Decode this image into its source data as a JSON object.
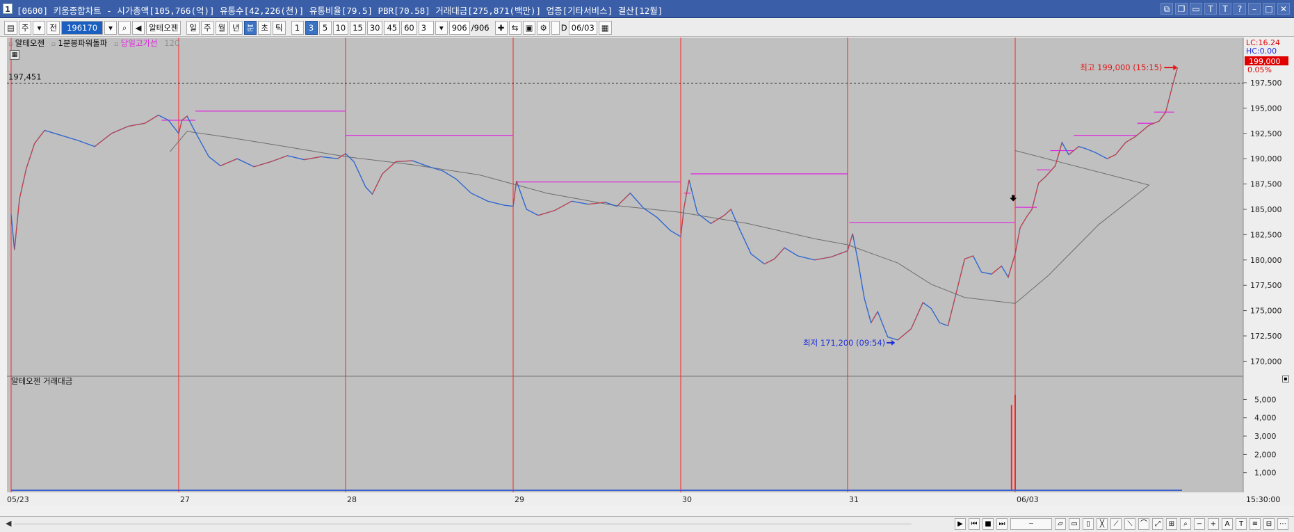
{
  "window": {
    "icon_label": "1",
    "title": "[0600] 키움종합차트 - 시가총액[105,766(억)] 유통수[42,226(천)] 유통비율[79.5] PBR[70.58] 거래대금[275,871(백만)] 업종[기타서비스] 결산[12월]"
  },
  "toolbar": {
    "period_sel": "주",
    "prev_btn": "전",
    "stock_code": "196170",
    "stock_name_btn": "알테오젠",
    "tf_day": "일",
    "tf_week": "주",
    "tf_month": "월",
    "tf_year": "년",
    "tf_minute": "분",
    "tf_second": "초",
    "tf_tick": "틱",
    "intervals": [
      "1",
      "3",
      "5",
      "10",
      "15",
      "30",
      "45",
      "60"
    ],
    "interval_selected": "3",
    "count_value": "3",
    "range_value": "906",
    "range_total": "/906",
    "d_label": "D",
    "date_value": "06/03"
  },
  "legend": {
    "stock": "알테오젠",
    "indicator1": "1분봉파워돌파",
    "indicator2": "당일고가선",
    "indicator2_param": "120",
    "current_ref_price": "197,451",
    "max_label": "최고 199,000 (15:15)",
    "min_label": "최저 171,200 (09:54)",
    "lc_label": "LC:16.24",
    "hc_label": "HC:0.00",
    "current_price": "199,000",
    "current_pct": "0.05%",
    "volume_title": "알테오젠 거래대금",
    "time_label": "15:30:00"
  },
  "chart_data": {
    "type": "line",
    "title": "",
    "xlabel": "",
    "ylabel": "",
    "x_date_labels": [
      "05/23",
      "27",
      "28",
      "29",
      "30",
      "31",
      "06/03"
    ],
    "price_axis": {
      "ylim": [
        169000,
        201000
      ],
      "ticks": [
        170000,
        172500,
        175000,
        177500,
        180000,
        182500,
        185000,
        187500,
        190000,
        192500,
        195000,
        197500
      ],
      "tick_labels": [
        "170,000",
        "172,500",
        "175,000",
        "177,500",
        "180,000",
        "182,500",
        "185,000",
        "187,500",
        "190,000",
        "192,500",
        "195,000",
        "197,500"
      ]
    },
    "volume_axis": {
      "ylim": [
        0,
        5700
      ],
      "ticks": [
        1000,
        2000,
        3000,
        4000,
        5000
      ],
      "tick_labels": [
        "1,000",
        "2,000",
        "3,000",
        "4,000",
        "5,000"
      ]
    },
    "price_path": [
      [
        0,
        184500
      ],
      [
        0.02,
        181000
      ],
      [
        0.05,
        186000
      ],
      [
        0.09,
        189000
      ],
      [
        0.14,
        191500
      ],
      [
        0.2,
        192800
      ],
      [
        0.3,
        192300
      ],
      [
        0.4,
        191800
      ],
      [
        0.5,
        191200
      ],
      [
        0.6,
        192500
      ],
      [
        0.7,
        193200
      ],
      [
        0.8,
        193500
      ],
      [
        0.88,
        194300
      ],
      [
        0.94,
        193800
      ],
      [
        1.0,
        192500
      ],
      [
        1.02,
        193800
      ],
      [
        1.05,
        194200
      ],
      [
        1.1,
        192600
      ],
      [
        1.18,
        190200
      ],
      [
        1.25,
        189300
      ],
      [
        1.35,
        190000
      ],
      [
        1.45,
        189200
      ],
      [
        1.55,
        189700
      ],
      [
        1.65,
        190300
      ],
      [
        1.75,
        189900
      ],
      [
        1.85,
        190200
      ],
      [
        1.95,
        190000
      ],
      [
        2.0,
        190500
      ],
      [
        2.05,
        189700
      ],
      [
        2.12,
        187200
      ],
      [
        2.16,
        186500
      ],
      [
        2.22,
        188500
      ],
      [
        2.3,
        189700
      ],
      [
        2.4,
        189800
      ],
      [
        2.5,
        189200
      ],
      [
        2.58,
        188800
      ],
      [
        2.66,
        188000
      ],
      [
        2.75,
        186600
      ],
      [
        2.85,
        185800
      ],
      [
        2.95,
        185400
      ],
      [
        3.0,
        185300
      ],
      [
        3.02,
        187800
      ],
      [
        3.08,
        185000
      ],
      [
        3.15,
        184400
      ],
      [
        3.25,
        184900
      ],
      [
        3.35,
        185800
      ],
      [
        3.45,
        185500
      ],
      [
        3.55,
        185700
      ],
      [
        3.62,
        185300
      ],
      [
        3.7,
        186600
      ],
      [
        3.78,
        185100
      ],
      [
        3.86,
        184200
      ],
      [
        3.94,
        182900
      ],
      [
        4.0,
        182300
      ],
      [
        4.02,
        185200
      ],
      [
        4.05,
        187900
      ],
      [
        4.1,
        184600
      ],
      [
        4.18,
        183600
      ],
      [
        4.26,
        184400
      ],
      [
        4.3,
        185000
      ],
      [
        4.35,
        183100
      ],
      [
        4.42,
        180600
      ],
      [
        4.5,
        179600
      ],
      [
        4.56,
        180100
      ],
      [
        4.62,
        181200
      ],
      [
        4.7,
        180400
      ],
      [
        4.8,
        180000
      ],
      [
        4.9,
        180300
      ],
      [
        5.0,
        180900
      ],
      [
        5.03,
        182600
      ],
      [
        5.06,
        180100
      ],
      [
        5.1,
        176200
      ],
      [
        5.14,
        173800
      ],
      [
        5.18,
        174900
      ],
      [
        5.24,
        172400
      ],
      [
        5.3,
        172100
      ],
      [
        5.38,
        173200
      ],
      [
        5.45,
        175800
      ],
      [
        5.5,
        175200
      ],
      [
        5.55,
        173800
      ],
      [
        5.6,
        173500
      ],
      [
        5.65,
        176800
      ],
      [
        5.7,
        180100
      ],
      [
        5.75,
        180400
      ],
      [
        5.8,
        178800
      ],
      [
        5.86,
        178600
      ],
      [
        5.92,
        179400
      ],
      [
        5.96,
        178300
      ],
      [
        6.0,
        180600
      ],
      [
        6.03,
        183200
      ],
      [
        6.07,
        184300
      ],
      [
        6.1,
        185000
      ],
      [
        6.14,
        187600
      ],
      [
        6.18,
        188200
      ],
      [
        6.24,
        189300
      ],
      [
        6.28,
        191600
      ],
      [
        6.32,
        190400
      ],
      [
        6.38,
        191200
      ],
      [
        6.42,
        191000
      ],
      [
        6.48,
        190600
      ],
      [
        6.55,
        190000
      ],
      [
        6.6,
        190400
      ],
      [
        6.66,
        191600
      ],
      [
        6.72,
        192200
      ],
      [
        6.8,
        193300
      ],
      [
        6.86,
        193700
      ],
      [
        6.9,
        194600
      ],
      [
        6.94,
        197200
      ],
      [
        6.97,
        199000
      ]
    ],
    "ma_path": [
      [
        0.95,
        190700
      ],
      [
        1.05,
        192700
      ],
      [
        1.3,
        192100
      ],
      [
        1.6,
        191300
      ],
      [
        2.0,
        190200
      ],
      [
        2.4,
        189400
      ],
      [
        2.8,
        188400
      ],
      [
        3.2,
        186600
      ],
      [
        3.6,
        185400
      ],
      [
        4.0,
        184700
      ],
      [
        4.4,
        183600
      ],
      [
        4.8,
        182100
      ],
      [
        5.0,
        181500
      ],
      [
        5.3,
        179700
      ],
      [
        5.5,
        177600
      ],
      [
        5.7,
        176300
      ],
      [
        6.0,
        175700
      ],
      [
        6.2,
        178500
      ],
      [
        6.5,
        183500
      ],
      [
        6.8,
        187400
      ],
      [
        7.0,
        190800
      ]
    ],
    "high_line_segments": [
      {
        "day": 0,
        "from": 0.9,
        "to": 1.0,
        "price": 193800
      },
      {
        "day": 1,
        "from": 1.0,
        "to": 1.1,
        "price": 193800
      },
      {
        "day": 1,
        "from": 1.1,
        "to": 2.0,
        "price": 194700
      },
      {
        "day": 2,
        "from": 2.0,
        "to": 3.0,
        "price": 192300
      },
      {
        "day": 3,
        "from": 3.02,
        "to": 4.0,
        "price": 187700
      },
      {
        "day": 4,
        "from": 4.02,
        "to": 4.06,
        "price": 186600
      },
      {
        "day": 4,
        "from": 4.06,
        "to": 5.0,
        "price": 188500
      },
      {
        "day": 5,
        "from": 5.01,
        "to": 6.0,
        "price": 183700
      },
      {
        "day": 6,
        "from": 6.0,
        "to": 6.05,
        "price": 185200
      },
      {
        "day": 6,
        "from": 6.05,
        "to": 6.13,
        "price": 185200
      },
      {
        "day": 6,
        "from": 6.13,
        "to": 6.21,
        "price": 188900
      },
      {
        "day": 6,
        "from": 6.21,
        "to": 6.35,
        "price": 190800
      },
      {
        "day": 6,
        "from": 6.35,
        "to": 6.73,
        "price": 192300
      },
      {
        "day": 6,
        "from": 6.73,
        "to": 6.83,
        "price": 193500
      },
      {
        "day": 6,
        "from": 6.83,
        "to": 6.95,
        "price": 194600
      }
    ],
    "volume_spikes": [
      [
        5.98,
        4700
      ],
      [
        6.0,
        5250
      ]
    ],
    "ref_line": 197451
  },
  "colors": {
    "chart_bg": "#c0c0c0",
    "price_line": "#2f66d0",
    "up_tick": "#e23a2a",
    "ma_line": "#6d6d6d",
    "high_line": "#e021e0",
    "day_divider": "#ff2222",
    "max_label": "#e01818",
    "min_label": "#1f2fd8"
  }
}
